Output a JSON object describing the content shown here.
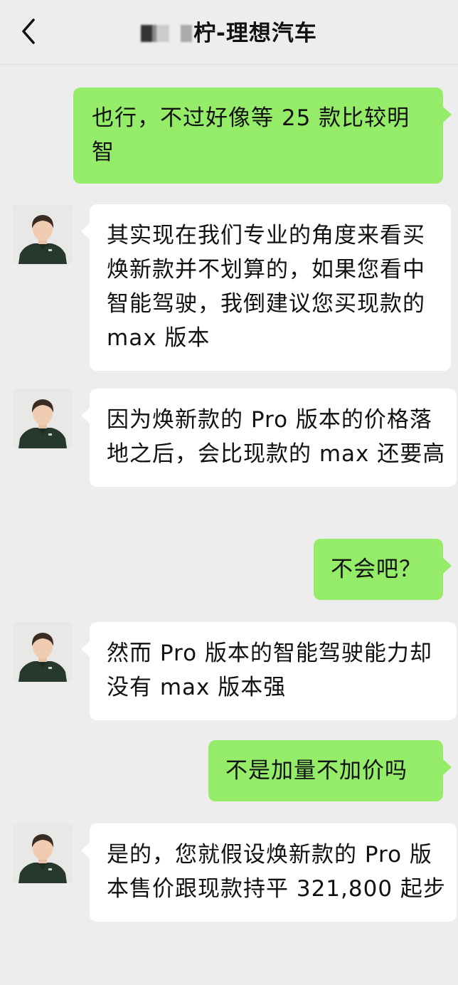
{
  "header": {
    "title": "柠-理想汽车"
  },
  "messages": [
    {
      "sender": "me",
      "text": "也行，不过好像等 25 款比较明智"
    },
    {
      "sender": "other",
      "text": "其实现在我们专业的角度来看买焕新款并不划算的，如果您看中智能驾驶，我倒建议您买现款的 max 版本"
    },
    {
      "sender": "other",
      "text": "因为焕新款的 Pro 版本的价格落地之后，会比现款的 max 还要高"
    },
    {
      "sender": "me",
      "text": "不会吧？"
    },
    {
      "sender": "other",
      "text": "然而 Pro 版本的智能驾驶能力却没有 max 版本强"
    },
    {
      "sender": "me",
      "text": "不是加量不加价吗"
    },
    {
      "sender": "other",
      "text": "是的，您就假设焕新款的 Pro 版本售价跟现款持平 321,800 起步"
    }
  ],
  "colors": {
    "my_bubble": "#95ec69",
    "other_bubble": "#ffffff",
    "background": "#ededed"
  },
  "icons": {
    "back": "chevron-left-icon",
    "avatar": "person-avatar"
  }
}
